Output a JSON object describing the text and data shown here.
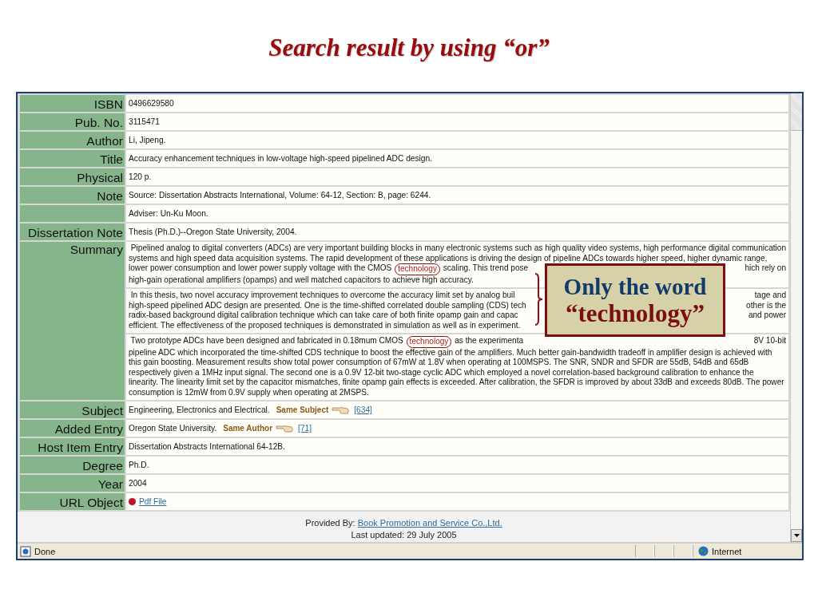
{
  "slide_title": "Search result by using “or”",
  "record": [
    {
      "kind": "text",
      "label": "ISBN",
      "value": "0496629580"
    },
    {
      "kind": "text",
      "label": "Pub. No.",
      "value": "3115471"
    },
    {
      "kind": "text",
      "label": "Author",
      "value": "Li, Jipeng."
    },
    {
      "kind": "text",
      "label": "Title",
      "value": "Accuracy enhancement techniques in low-voltage high-speed pipelined ADC design."
    },
    {
      "kind": "text",
      "label": "Physical",
      "value": "120 p."
    },
    {
      "kind": "text",
      "label": "Note",
      "value": "Source: Dissertation Abstracts International, Volume: 64-12, Section: B, page: 6244."
    },
    {
      "kind": "text",
      "value": "Adviser: Un-Ku Moon."
    },
    {
      "kind": "text",
      "label": "Dissertation Note",
      "value": "Thesis (Ph.D.)--Oregon State University, 2004."
    },
    {
      "kind": "summary",
      "label": "Summary",
      "paragraphs": [
        {
          "lines": [
            {
              "left": [
                {
                  "text": " Pipelined analog to digital converters (ADCs) are very important building blocks in many electronic systems such as high quality video systems, high performance digital communication",
                  "hit": false
                }
              ]
            },
            {
              "left": [
                {
                  "text": "systems and high speed data acquisition systems. The rapid development of these applications is driving the design of pipeline ADCs towards higher speed, higher dynamic range,",
                  "hit": false
                }
              ]
            },
            {
              "left": [
                {
                  "text": "lower power consumption and lower power supply voltage with the CMOS ",
                  "hit": false
                },
                {
                  "text": "technology",
                  "hit": true
                },
                {
                  "text": " scaling. This trend pose",
                  "hit": false
                }
              ],
              "right": "hich rely on"
            },
            {
              "left": [
                {
                  "text": "high-gain operational amplifiers (opamps) and well matched capacitors to achieve high accuracy.",
                  "hit": false
                }
              ]
            }
          ]
        },
        {
          "lines": [
            {
              "left": [
                {
                  "text": " In this thesis, two novel accuracy improvement techniques to overcome the accuracy limit set by analog buil",
                  "hit": false
                }
              ],
              "right": "tage and"
            },
            {
              "left": [
                {
                  "text": "high-speed pipelined ADC design are presented. One is the time-shifted correlated double sampling (CDS) tech",
                  "hit": false
                }
              ],
              "right": "other is the"
            },
            {
              "left": [
                {
                  "text": "radix-based background digital calibration technique which can take care of both finite opamp gain and capac",
                  "hit": false
                }
              ],
              "right": "and power"
            },
            {
              "left": [
                {
                  "text": "efficient. The effectiveness of the proposed techniques is demonstrated in simulation as well as in experiment.",
                  "hit": false
                }
              ]
            }
          ]
        },
        {
          "lines": [
            {
              "left": [
                {
                  "text": " Two prototype ADCs have been designed and fabricated in 0.18mum CMOS ",
                  "hit": false
                },
                {
                  "text": "technology",
                  "hit": true
                },
                {
                  "text": " as the experimenta",
                  "hit": false
                }
              ],
              "right": "8V 10-bit"
            },
            {
              "left": [
                {
                  "text": "pipeline ADC which incorporated the time-shifted CDS technique to boost the effective gain of the amplifiers. Much better gain-bandwidth tradeoff in amplifier design is achieved with",
                  "hit": false
                }
              ]
            },
            {
              "left": [
                {
                  "text": "this gain boosting. Measurement results show total power consumption of 67mW at 1.8V when operating at 100MSPS. The SNR, SNDR and SFDR are 55dB, 54dB and 65dB",
                  "hit": false
                }
              ]
            },
            {
              "left": [
                {
                  "text": "respectively given a 1MHz input signal. The second one is a 0.9V 12-bit two-stage cyclic ADC which employed a novel correlation-based background calibration to enhance the",
                  "hit": false
                }
              ]
            },
            {
              "left": [
                {
                  "text": "linearity. The linearity limit set by the capacitor mismatches, finite opamp gain effects is exceeded. After calibration, the SFDR is improved by about 33dB and exceeds 80dB. The power",
                  "hit": false
                }
              ]
            },
            {
              "left": [
                {
                  "text": "consumption is 12mW from 0.9V supply when operating at 2MSPS.",
                  "hit": false
                }
              ]
            }
          ]
        }
      ],
      "callout": [
        "Only the word",
        "“technology”"
      ]
    },
    {
      "kind": "related",
      "label": "Subject",
      "value": "Engineering, Electronics and Electrical.",
      "caption": "Same Subject",
      "count": "[634]"
    },
    {
      "kind": "related",
      "label": "Added Entry",
      "value": "Oregon State University.",
      "caption": "Same Author",
      "count": "[71]"
    },
    {
      "kind": "text",
      "label": "Host Item Entry",
      "value": "Dissertation Abstracts International 64-12B."
    },
    {
      "kind": "text",
      "label": "Degree",
      "value": "Ph.D."
    },
    {
      "kind": "text",
      "label": "Year",
      "value": "2004"
    },
    {
      "kind": "link",
      "label": "URL Object",
      "value": "Pdf File"
    }
  ],
  "footer": {
    "provided_by": "Provided By:",
    "provider": "Book Promotion and Service Co.,Ltd.",
    "updated": "Last updated: 29 July 2005"
  },
  "status_bar": {
    "status": "Done",
    "zone": "Internet"
  }
}
